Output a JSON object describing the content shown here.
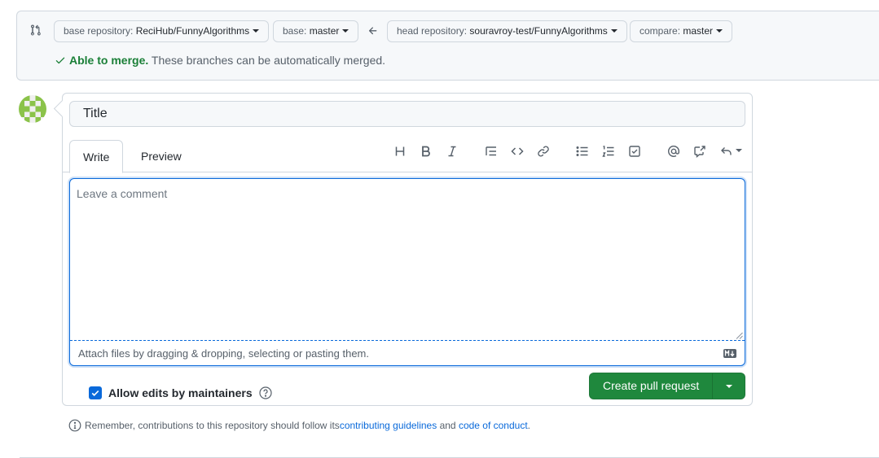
{
  "compare_bar": {
    "base_repo": {
      "prefix": "base repository: ",
      "value": "ReciHub/FunnyAlgorithms"
    },
    "base_branch": {
      "prefix": "base: ",
      "value": "master"
    },
    "head_repo": {
      "prefix": "head repository: ",
      "value": "souravroy-test/FunnyAlgorithms"
    },
    "compare_branch": {
      "prefix": "compare: ",
      "value": "master"
    },
    "merge_status": {
      "bold": "Able to merge.",
      "text": " These branches can be automatically merged."
    }
  },
  "form": {
    "title_placeholder": "Title",
    "tabs": [
      {
        "label": "Write"
      },
      {
        "label": "Preview"
      }
    ],
    "toolbar_icons": [
      "heading-icon",
      "bold-icon",
      "italic-icon",
      "quote-icon",
      "code-icon",
      "link-icon",
      "unordered-list-icon",
      "ordered-list-icon",
      "task-list-icon",
      "mention-icon",
      "cross-reference-icon",
      "reply-icon"
    ],
    "comment_placeholder": "Leave a comment",
    "attach_text": "Attach files by dragging & dropping, selecting or pasting them.",
    "allow_edits_label": "Allow edits by maintainers",
    "allow_edits_checked": true,
    "create_button_label": "Create pull request"
  },
  "footer": {
    "prefix": "Remember, contributions to this repository should follow its ",
    "link1": "contributing guidelines",
    "middle": " and ",
    "link2": "code of conduct",
    "suffix": "."
  },
  "colors": {
    "accent": "#0969da",
    "success": "#1f883d",
    "success_text": "#1a7f37",
    "avatar": "#8bc34a"
  }
}
